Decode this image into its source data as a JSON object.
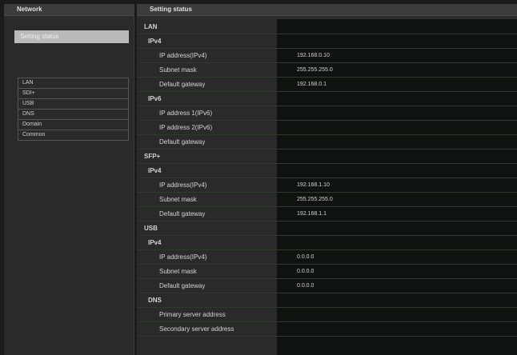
{
  "left": {
    "header": "Network",
    "setting_status_button": "Setting status",
    "nav_items": [
      "LAN",
      "SDI+",
      "USB",
      "DNS",
      "Domain",
      "Common"
    ]
  },
  "right": {
    "header": "Setting status",
    "lan": {
      "title": "LAN",
      "ipv4": {
        "title": "IPv4",
        "ip_label": "IP address(IPv4)",
        "ip_value": "192.168.0.10",
        "mask_label": "Subnet mask",
        "mask_value": "255.255.255.0",
        "gw_label": "Default gateway",
        "gw_value": "192.168.0.1"
      },
      "ipv6": {
        "title": "IPv6",
        "ip1_label": "IP address 1(IPv6)",
        "ip2_label": "IP address 2(IPv6)",
        "gw_label": "Default gateway"
      }
    },
    "sfp": {
      "title": "SFP+",
      "ipv4": {
        "title": "IPv4",
        "ip_label": "IP address(IPv4)",
        "ip_value": "192.168.1.10",
        "mask_label": "Subnet mask",
        "mask_value": "255.255.255.0",
        "gw_label": "Default gateway",
        "gw_value": "192.168.1.1"
      }
    },
    "usb": {
      "title": "USB",
      "ipv4": {
        "title": "IPv4",
        "ip_label": "IP address(IPv4)",
        "ip_value": "0.0.0.0",
        "mask_label": "Subnet mask",
        "mask_value": "0.0.0.0",
        "gw_label": "Default gateway",
        "gw_value": "0.0.0.0"
      }
    },
    "dns": {
      "title": "DNS",
      "primary_label": "Primary server address",
      "secondary_label": "Secondary server address"
    }
  }
}
